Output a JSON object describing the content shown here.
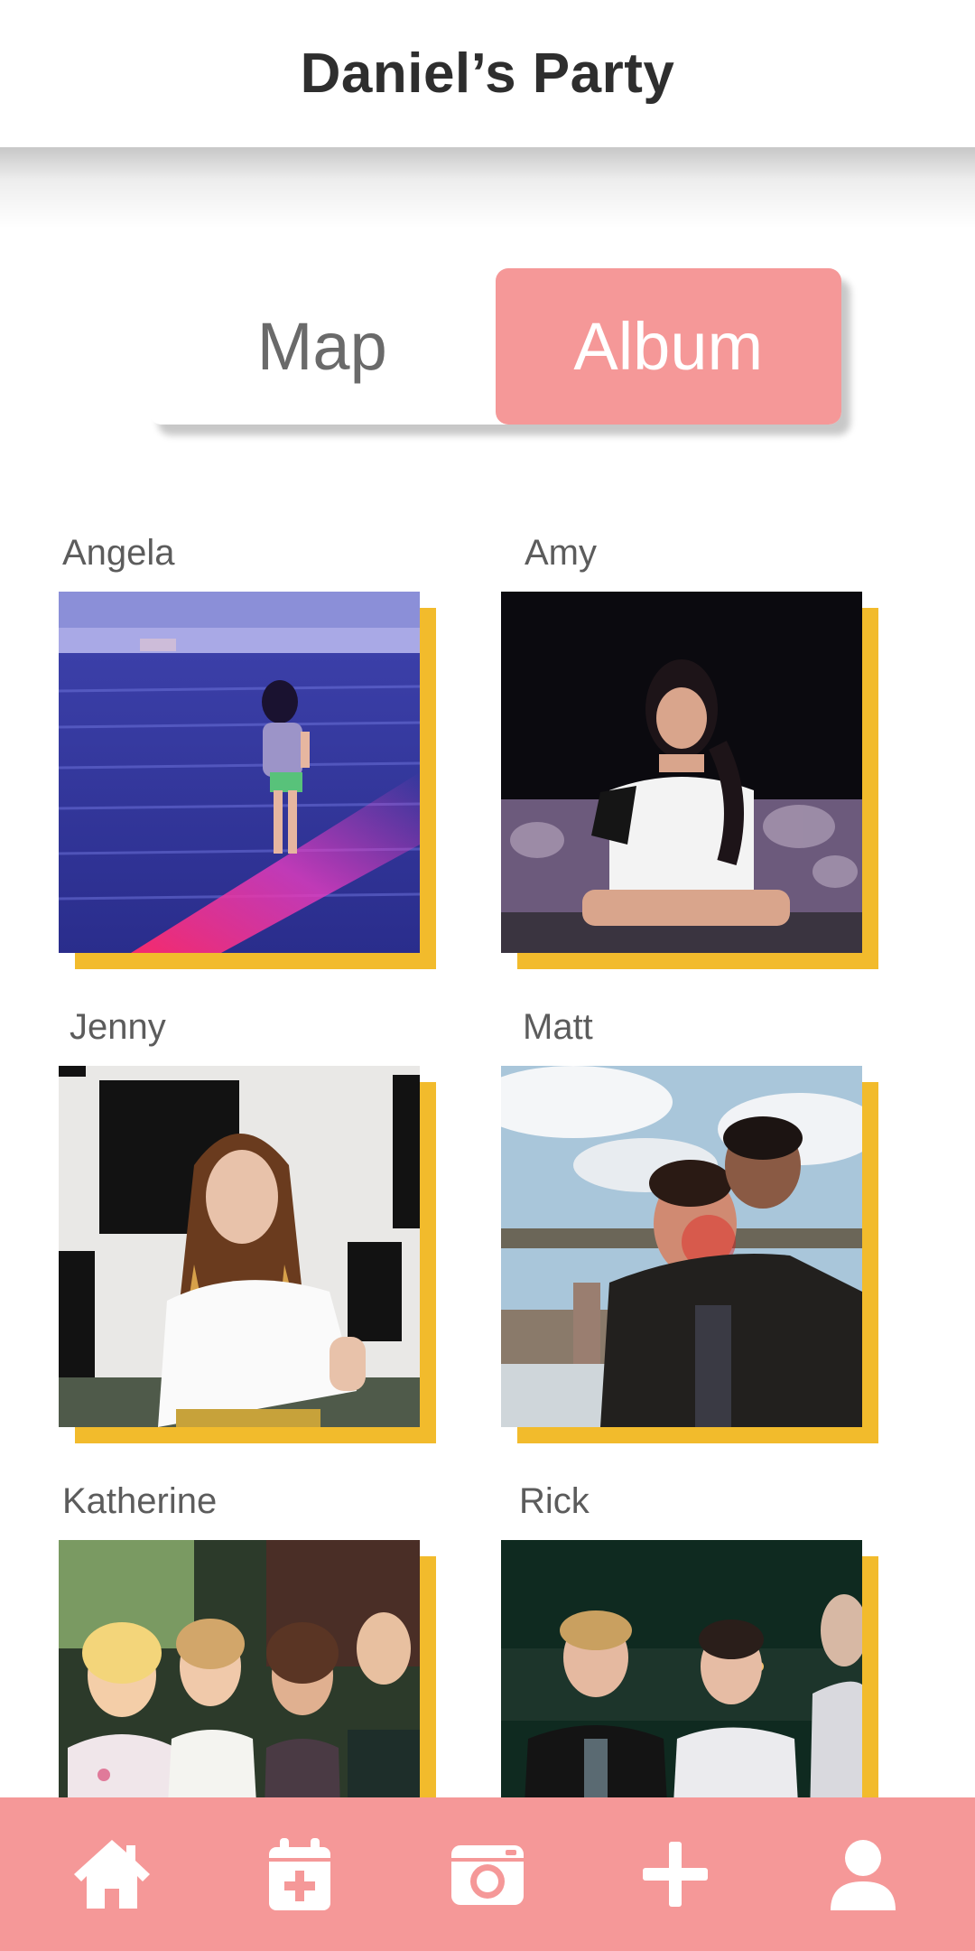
{
  "header": {
    "title": "Daniel’s Party"
  },
  "toggle": {
    "map_label": "Map",
    "album_label": "Album",
    "active": "Album"
  },
  "album": {
    "photos": [
      {
        "name": "Angela",
        "scene": "beach"
      },
      {
        "name": "Amy",
        "scene": "night-sitting"
      },
      {
        "name": "Jenny",
        "scene": "checker-wall"
      },
      {
        "name": "Matt",
        "scene": "bridge-couple"
      },
      {
        "name": "Katherine",
        "scene": "wedding-group"
      },
      {
        "name": "Rick",
        "scene": "night-group"
      }
    ]
  },
  "nav": {
    "items": [
      {
        "icon": "home-icon"
      },
      {
        "icon": "calendar-add-icon"
      },
      {
        "icon": "camera-icon"
      },
      {
        "icon": "plus-icon"
      },
      {
        "icon": "user-icon"
      }
    ]
  },
  "colors": {
    "accent": "#f59898",
    "photo_shadow": "#f2bb2c",
    "title": "#2e2e2e",
    "label": "#5c5c5c"
  }
}
